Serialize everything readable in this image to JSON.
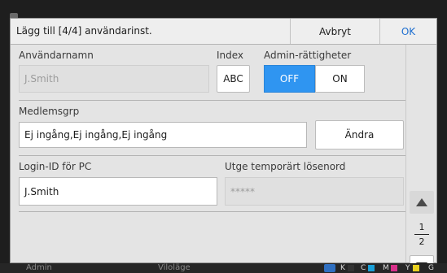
{
  "header": {
    "title": "Lägg till [4/4] användarinst.",
    "cancel_label": "Avbryt",
    "ok_label": "OK",
    "ok_color": "#1e6fd0"
  },
  "username": {
    "label": "Användarnamn",
    "value": "J.Smith"
  },
  "index": {
    "label": "Index",
    "value": "ABC"
  },
  "admin": {
    "label": "Admin-rättigheter",
    "off_label": "OFF",
    "on_label": "ON",
    "selected": "OFF",
    "selected_color": "#2f95f1"
  },
  "group": {
    "label": "Medlemsgrp",
    "value": "Ej ingång,Ej ingång,Ej ingång",
    "change_label": "Ändra"
  },
  "login": {
    "label": "Login-ID för PC",
    "value": "J.Smith"
  },
  "temp_password": {
    "label": "Utge temporärt lösenord",
    "value": "*****"
  },
  "pager": {
    "current": "1",
    "total": "2",
    "up_icon": "triangle-up-icon",
    "down_icon": "triangle-down-icon"
  },
  "status": {
    "user": "Admin",
    "mode": "Viloläge",
    "inks": [
      {
        "label": "K",
        "color": "#333333"
      },
      {
        "label": "C",
        "color": "#1aa0d8"
      },
      {
        "label": "M",
        "color": "#d8308a"
      },
      {
        "label": "Y",
        "color": "#e8d020"
      },
      {
        "label": "G",
        "color": "#888888"
      }
    ]
  }
}
